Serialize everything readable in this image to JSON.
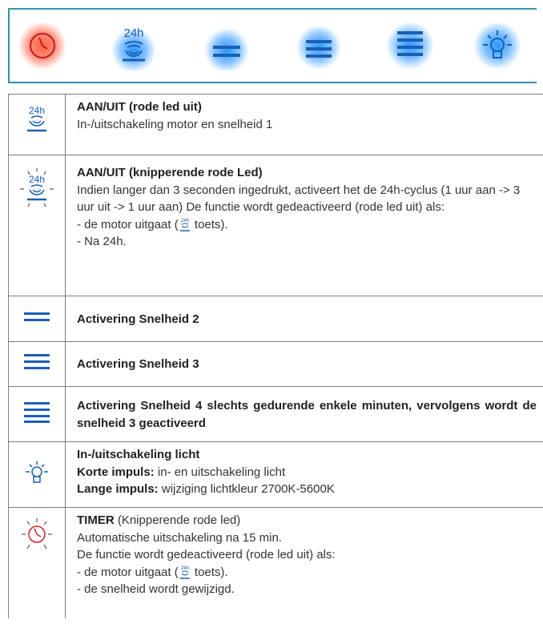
{
  "panel": {
    "buttons": [
      {
        "icon": "timer-icon",
        "glow": "red"
      },
      {
        "icon": "24h-cycle-icon",
        "glow": "blue",
        "label": "24h"
      },
      {
        "icon": "speed-2-icon",
        "glow": "blue"
      },
      {
        "icon": "speed-3-icon",
        "glow": "blue"
      },
      {
        "icon": "speed-4-icon",
        "glow": "blue"
      },
      {
        "icon": "light-icon",
        "glow": "blue"
      }
    ]
  },
  "icon_label_24h": "24h",
  "rows": {
    "onoff": {
      "title": "AAN/UIT (rode led uit)",
      "text": "In-/uitschakeling motor en snelheid 1"
    },
    "blink": {
      "title": "AAN/UIT (knipperende rode Led)",
      "text": "Indien langer dan 3 seconden ingedrukt, activeert het de 24h-cyclus (1 uur aan -> 3 uur uit -> 1 uur aan) De functie wordt gedeactiveerd (rode led uit) als:",
      "item1_pre": "- de motor uitgaat (",
      "item1_post": " toets).",
      "item2": "- Na 24h."
    },
    "speed2": {
      "title": "Activering Snelheid 2"
    },
    "speed3": {
      "title": "Activering Snelheid 3"
    },
    "speed4": {
      "title": "Activering Snelheid 4 slechts gedurende enkele minuten, vervolgens wordt de snelheid 3 geactiveerd"
    },
    "light": {
      "title": "In-/uitschakeling licht",
      "short_label": "Korte impuls:",
      "short_text": " in- en uitschakeling licht",
      "long_label": "Lange impuls:",
      "long_text": " wijziging lichtkleur 2700K-5600K"
    },
    "timer": {
      "title": "TIMER",
      "title_note": " (Knipperende rode led)",
      "line1": "Automatische uitschakeling na 15 min.",
      "line2": "De functie wordt gedeactiveerd (rode led uit) als:",
      "item1_pre": "- de motor uitgaat (",
      "item1_post": " toets).",
      "item2": "- de snelheid wordt gewijzigd."
    }
  },
  "colors": {
    "accent": "#2e93ae",
    "icon_blue": "#1a5fb4",
    "glow_blue": "#1e90ff",
    "glow_red": "#ff4a2a",
    "timer_red": "#d42020"
  }
}
